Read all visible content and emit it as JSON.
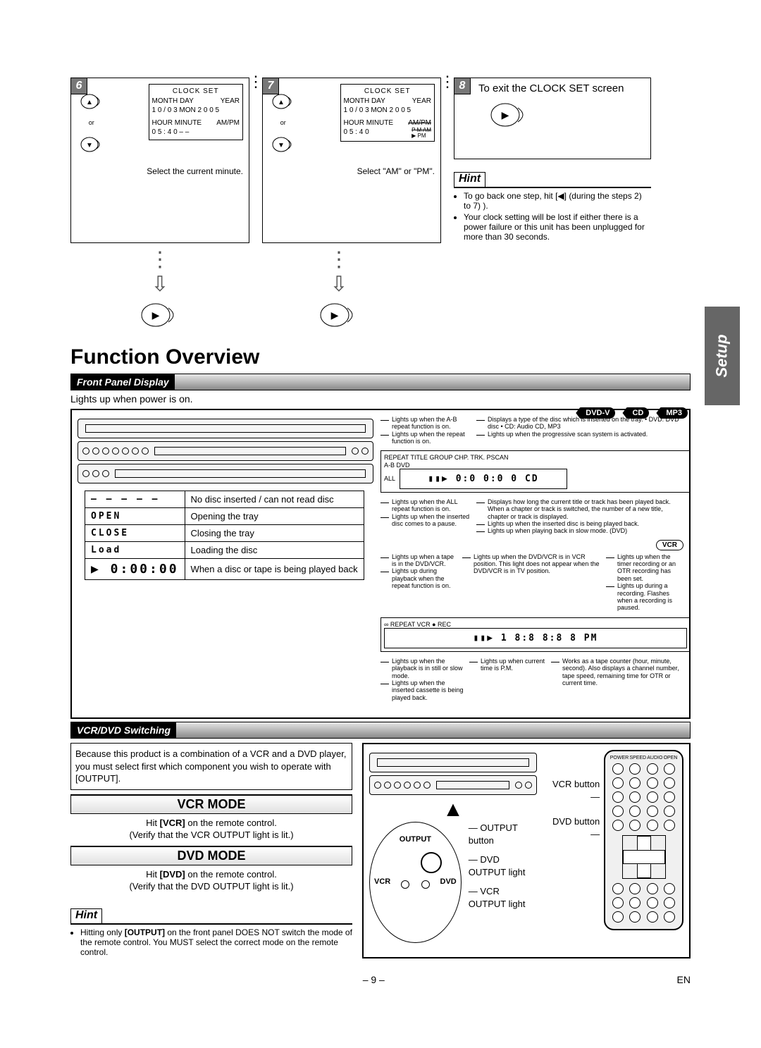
{
  "steps": {
    "s6": {
      "num": "6",
      "clock": {
        "title": "CLOCK SET",
        "line1_left": "MONTH  DAY",
        "line1_right": "YEAR",
        "line2": "1 0  /  0 3  MON  2 0 0 5",
        "line3_left": "HOUR  MINUTE",
        "line3_right": "AM/PM",
        "line4": "0 5  :  4 0          – –"
      },
      "or": "or",
      "caption": "Select the current minute."
    },
    "s7": {
      "num": "7",
      "clock": {
        "title": "CLOCK SET",
        "line1_left": "MONTH  DAY",
        "line1_right": "YEAR",
        "line2": "1 0  /  0 3  MON  2 0 0 5",
        "line3_left": "HOUR  MINUTE",
        "line3_right": "AM/PM",
        "line4_left": "0 5  :  4 0",
        "line4_stack_top": "P M  AM",
        "line4_stack_bot": "▶ PM"
      },
      "or": "or",
      "caption": "Select \"AM\" or \"PM\"."
    },
    "s8": {
      "num": "8",
      "text": "To exit the CLOCK SET screen"
    }
  },
  "top_hint": {
    "label": "Hint",
    "items": [
      "To go back one step, hit [◀] (during the steps 2) to 7) ).",
      "Your clock setting will be lost if either there is a power failure or this unit has been unplugged for more than 30 seconds."
    ]
  },
  "h1": "Function Overview",
  "sec_front": "Front Panel Display",
  "front_caption": "Lights up when power is on.",
  "badges": {
    "dvd": "DVD-V",
    "cd": "CD",
    "mp3": "MP3"
  },
  "display_table": [
    {
      "seg": "– – – – –",
      "desc": "No disc inserted / can not read disc"
    },
    {
      "seg": "OPEN",
      "desc": "Opening the tray"
    },
    {
      "seg": "CLOSE",
      "desc": "Closing the tray"
    },
    {
      "seg": "Load",
      "desc": "Loading the disc"
    },
    {
      "seg": "▶ 0:00:00",
      "desc": "When a disc or tape is being played back"
    }
  ],
  "dvd_panel": {
    "top_labels": "REPEAT  TITLE GROUP  CHP. TRK.  PSCAN",
    "sub_labels": "A-B                                         DVD",
    "sub_labels2": "ALL",
    "readout": "▮▮▶  0:0 0:0 0       CD",
    "annots": [
      "Lights up when the A-B repeat function is on.",
      "Lights up when the repeat function is on.",
      "Lights up when the ALL repeat function is on.",
      "Lights up when the inserted disc comes to a pause.",
      "Displays a type of the disc which is inserted on the tray.  • DVD: DVD disc  • CD: Audio CD, MP3",
      "Lights up when the progressive scan system is activated.",
      "Displays how long the current title or track has been played back. When a chapter or track is switched, the number of a new title, chapter or track is displayed.",
      "Lights up when the inserted disc is being played back.",
      "Lights up when playing back in slow mode. (DVD)"
    ]
  },
  "vcr_badge": "VCR",
  "vcr_panel": {
    "top_labels": "∞ REPEAT    VCR  ●  REC",
    "readout": "▮▮▶ 1 8:8 8:8 8   PM",
    "annots_left": [
      "Lights up when a tape is in the DVD/VCR.",
      "Lights up during playback when the repeat function is on.",
      "Lights up when the playback is in still or slow mode.",
      "Lights up when the inserted cassette is being played back."
    ],
    "annots_mid": [
      "Lights up when the DVD/VCR is in VCR position. This light does not appear when the DVD/VCR is in TV position.",
      "Lights up when current time is P.M."
    ],
    "annots_right": [
      "Lights up when the timer recording or an OTR recording has been set.",
      "Lights up during a recording. Flashes when a recording is paused."
    ],
    "annot_bottom": "Works as a tape counter (hour, minute, second). Also displays a channel number, tape speed, remaining time for OTR or current time."
  },
  "sec_switch": "VCR/DVD Switching",
  "switch_intro": "Because this product is a combination of a VCR and a DVD player, you must select first which component you wish to operate with [OUTPUT].",
  "vcr_mode": {
    "hdr": "VCR MODE",
    "l1": "Hit [VCR] on the remote control.",
    "l2": "(Verify that the VCR OUTPUT light is lit.)"
  },
  "dvd_mode": {
    "hdr": "DVD MODE",
    "l1": "Hit [DVD] on the remote control.",
    "l2": "(Verify that the DVD OUTPUT light is lit.)"
  },
  "bottom_hint": {
    "label": "Hint",
    "item": "Hitting only [OUTPUT] on the front panel DOES NOT switch the mode of the remote control. You MUST select the correct mode on the remote control."
  },
  "callouts": {
    "vcr_btn": "VCR button",
    "dvd_btn": "DVD button",
    "out_btn": "OUTPUT button",
    "dvd_light": "DVD OUTPUT light",
    "vcr_light": "VCR OUTPUT light",
    "panel_out": "OUTPUT",
    "panel_vcr": "VCR",
    "panel_dvd": "DVD"
  },
  "side_tab": "Setup",
  "page_num": "– 9 –",
  "lang": "EN"
}
